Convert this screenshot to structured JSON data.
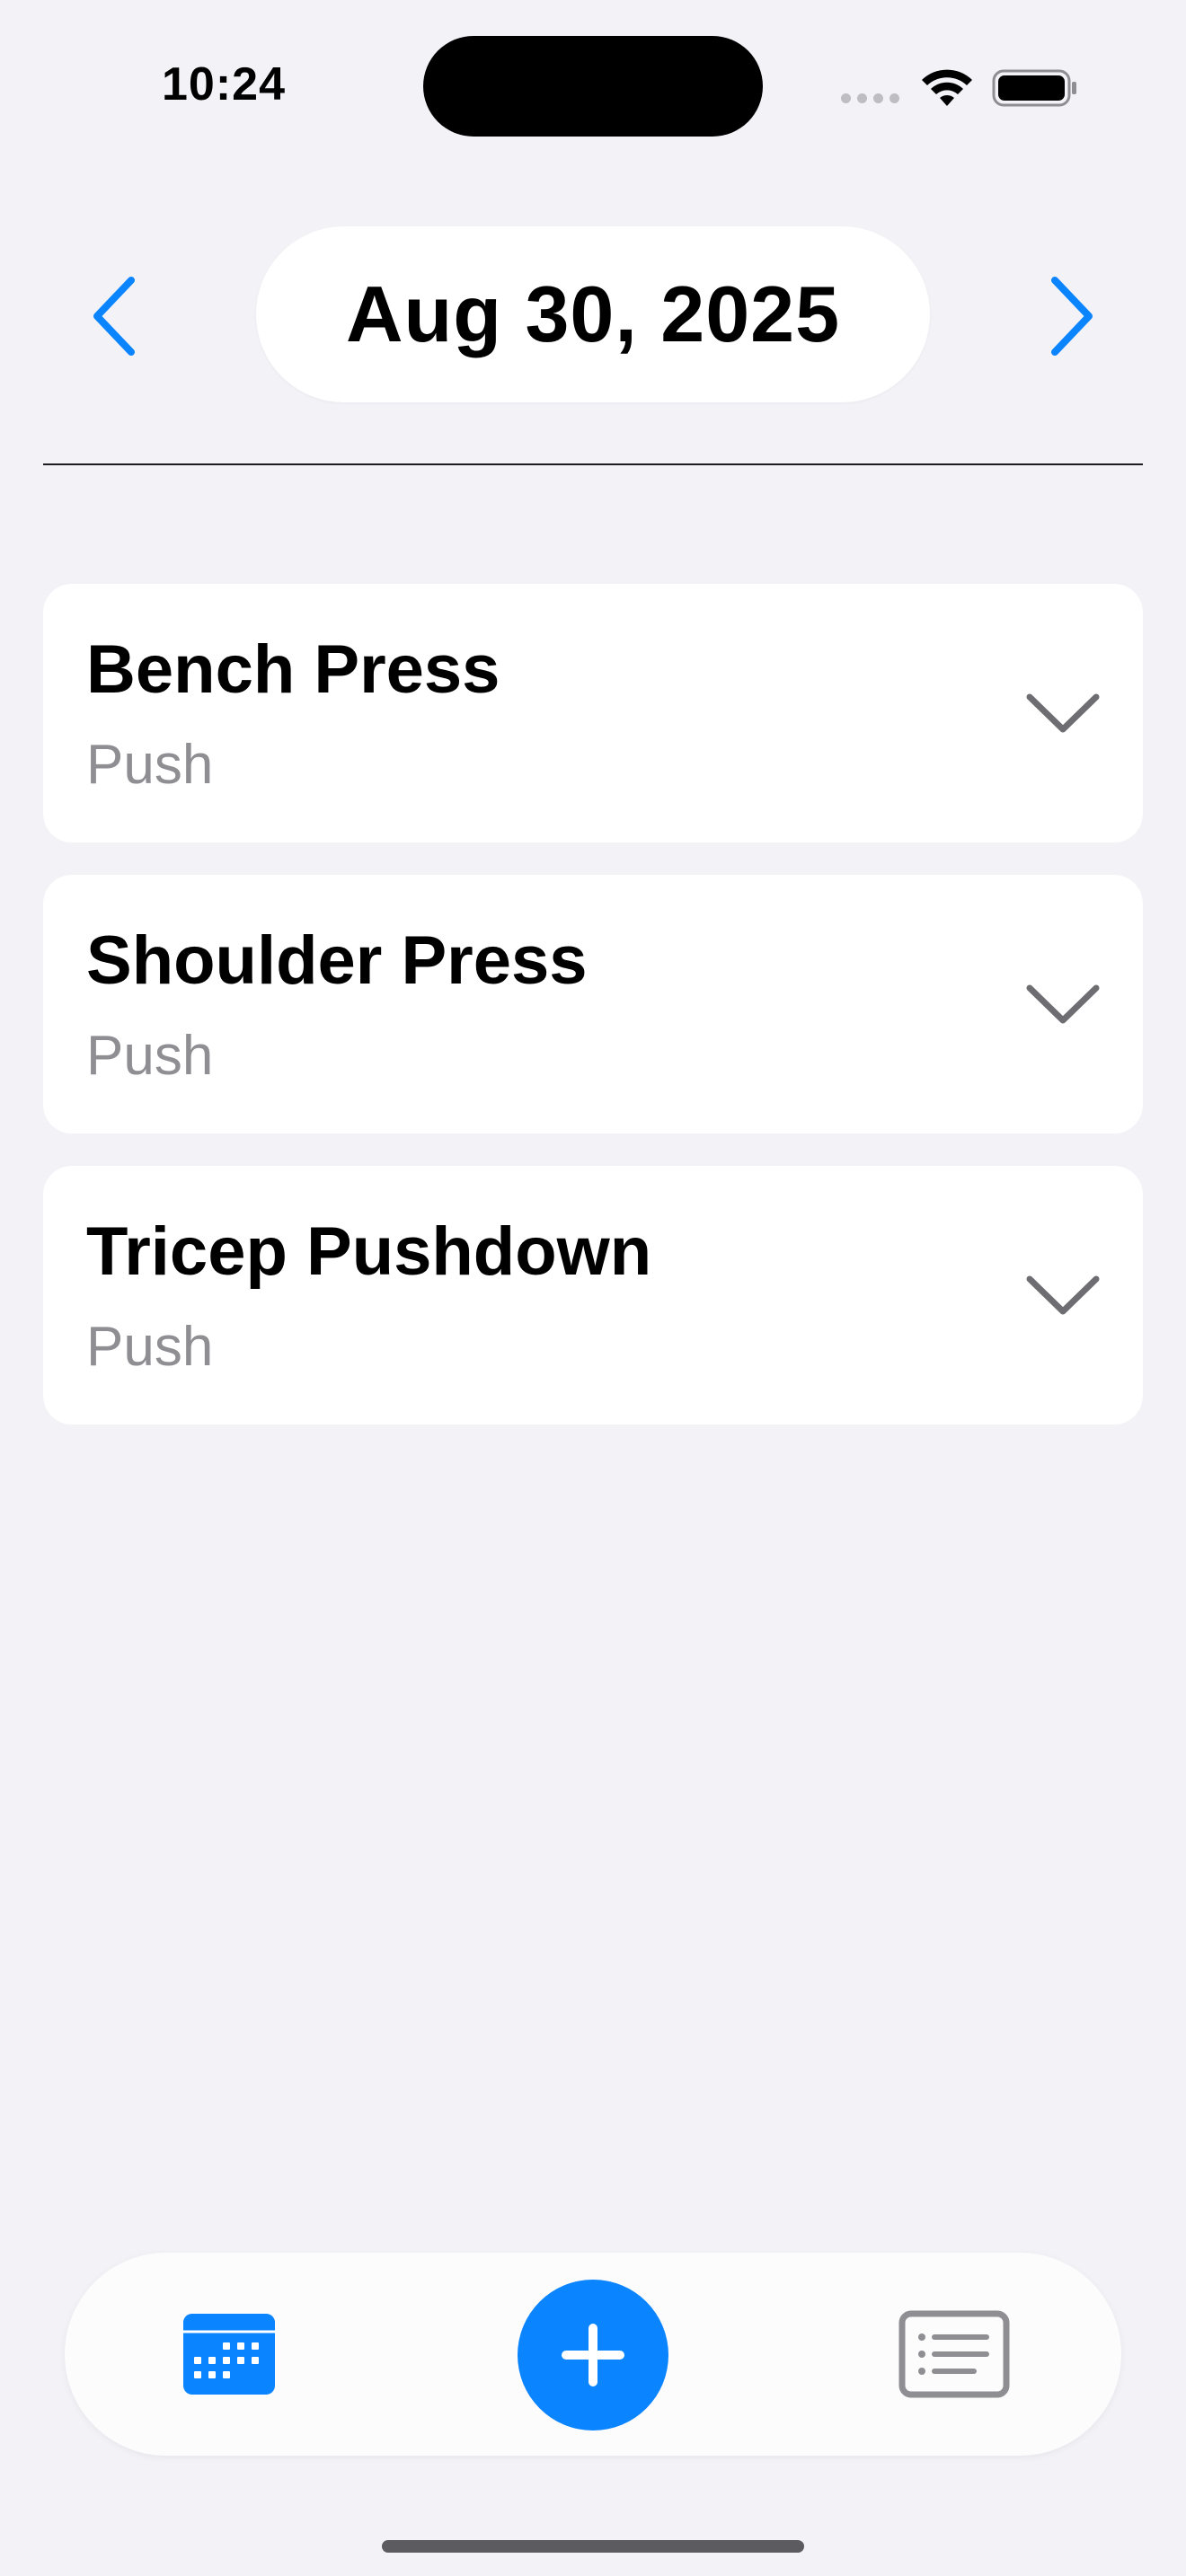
{
  "status_bar": {
    "time": "10:24",
    "icons": [
      "cellular-signal-icon",
      "wifi-icon",
      "battery-icon"
    ]
  },
  "date_nav": {
    "date": "Aug 30, 2025",
    "prev_icon": "chevron-left-icon",
    "next_icon": "chevron-right-icon"
  },
  "exercises": [
    {
      "name": "Bench Press",
      "category": "Push"
    },
    {
      "name": "Shoulder Press",
      "category": "Push"
    },
    {
      "name": "Tricep Pushdown",
      "category": "Push"
    }
  ],
  "tab_bar": {
    "items": [
      "calendar-icon",
      "plus-icon",
      "list-icon"
    ]
  },
  "colors": {
    "accent": "#0A84FF",
    "background": "#F2F2F7",
    "card": "#FFFFFF",
    "secondary_text": "#8E8E93"
  }
}
